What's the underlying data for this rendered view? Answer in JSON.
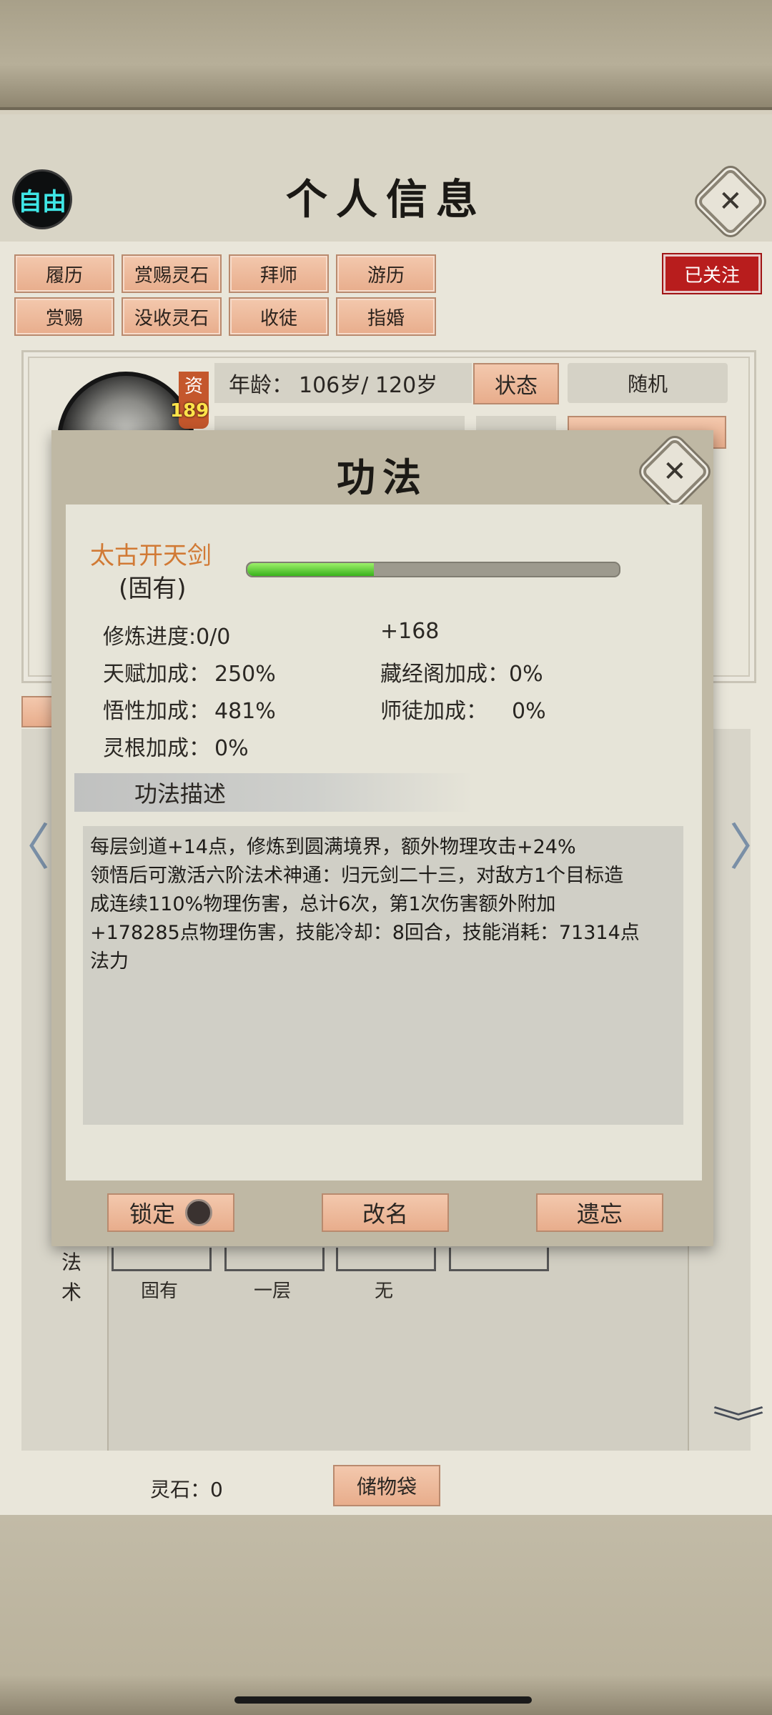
{
  "header": {
    "title": "个人信息",
    "mode_badge": "自由",
    "close_glyph": "✕"
  },
  "tabs": {
    "row1": [
      "履历",
      "赏赐灵石",
      "拜师",
      "游历"
    ],
    "row2": [
      "赏赐",
      "没收灵石",
      "收徒",
      "指婚"
    ],
    "followed_label": "已关注"
  },
  "profile": {
    "aptitude_label": "资",
    "aptitude_value": "189",
    "age_label": "年龄：",
    "age_value": "106岁/ 120岁",
    "state_button": "状态",
    "random_label": "随机"
  },
  "technique_modal": {
    "title": "功法",
    "name": "太古开天剑",
    "tag": "(固有)",
    "progress_fraction": 0.34,
    "stats_left": [
      {
        "label": "修炼进度:",
        "value": "0/0"
      },
      {
        "label": "天赋加成：",
        "value": "250%"
      },
      {
        "label": "悟性加成：",
        "value": "481%"
      },
      {
        "label": "灵根加成：",
        "value": "0%"
      }
    ],
    "stats_right": [
      {
        "label": "",
        "value": "+168"
      },
      {
        "label": "藏经阁加成：",
        "value": "0%"
      },
      {
        "label": "师徒加成：",
        "value": "0%"
      }
    ],
    "desc_header": "功法描述",
    "description_lines": [
      "每层剑道+14点，修炼到圆满境界，额外物理攻击+24%",
      "领悟后可激活六阶法术神通：归元剑二十三，对敌方1个目标造",
      "成连续110%物理伤害，总计6次，第1次伤害额外附加",
      "+178285点物理伤害，技能冷却：8回合，技能消耗：71314点",
      "法力"
    ],
    "buttons": {
      "lock": "锁定",
      "rename": "改名",
      "forget": "遗忘"
    }
  },
  "spells": {
    "section_label": "法\n术",
    "slots": [
      "固有",
      "一层",
      "无",
      ""
    ]
  },
  "footer": {
    "spirit_stone_label": "灵石：",
    "spirit_stone_value": "0",
    "bag_button": "储物袋"
  },
  "nav": {
    "left_arrow": "〈",
    "right_arrow": "〉",
    "down_chevron": "︾"
  },
  "colors": {
    "accent_peach": "#e8ad8c",
    "followed_red": "#b81d1d",
    "technique_name": "#d17a35",
    "progress_green": "#39b21c",
    "badge_cyan": "#3fe6e6"
  }
}
